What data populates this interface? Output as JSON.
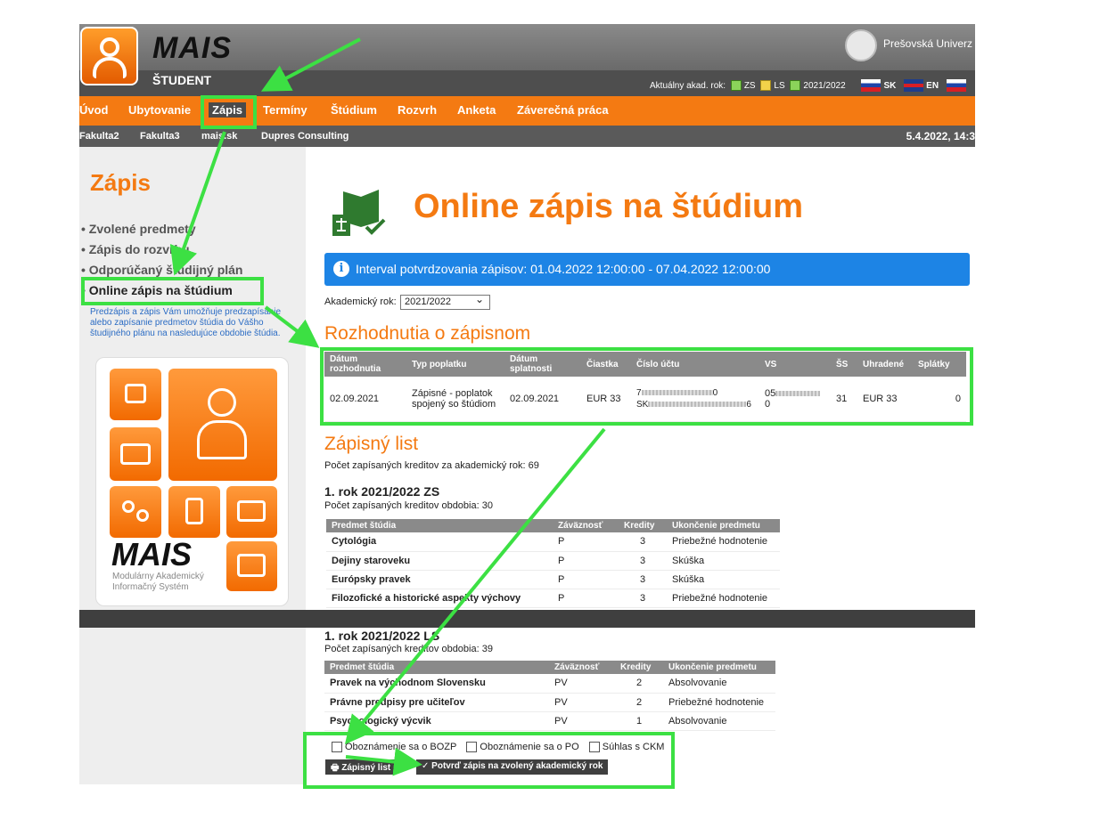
{
  "header": {
    "app_name": "MAIS",
    "role": "ŠTUDENT",
    "university": "Prešovská Univerz",
    "acad_year_label": "Aktuálny akad. rok:",
    "term_zs": "ZS",
    "term_ls": "LS",
    "current_year": "2021/2022",
    "lang_sk": "SK",
    "lang_en": "EN"
  },
  "nav": {
    "items": [
      "Úvod",
      "Ubytovanie",
      "Zápis",
      "Termíny",
      "Štúdium",
      "Rozvrh",
      "Anketa",
      "Záverečná práca"
    ],
    "active": "Zápis"
  },
  "subnav": {
    "items": [
      "Fakulta2",
      "Fakulta3",
      "mais.sk",
      "Dupres Consulting"
    ],
    "datetime": "5.4.2022, 14:3"
  },
  "sidebar": {
    "title": "Zápis",
    "links": [
      "Zvolené predmety",
      "Zápis do rozvrhu",
      "Odporúčaný študijný plán",
      "Online zápis na štúdium"
    ],
    "description": "Predzápis a zápis Vám umožňuje predzapísanie alebo zapísanie predmetov štúdia do Vášho študijného plánu na nasledujúce obdobie štúdia.",
    "brand": "MAIS",
    "brand_sub1": "Modulárny Akademický",
    "brand_sub2": "Informačný Systém"
  },
  "main": {
    "title": "Online zápis na štúdium",
    "info": "Interval potvrdzovania zápisov: 01.04.2022 12:00:00 - 07.04.2022 12:00:00",
    "year_label": "Akademický rok:",
    "year_value": "2021/2022",
    "decisions_title": "Rozhodnutia o zápisnom",
    "fee_headers": [
      "Dátum rozhodnutia",
      "Typ poplatku",
      "Dátum splatnosti",
      "Čiastka",
      "Číslo účtu",
      "VS",
      "ŠS",
      "Uhradené",
      "Splátky"
    ],
    "fee_row": {
      "date": "02.09.2021",
      "type": "Zápisné - poplatok spojený so štúdiom",
      "due": "02.09.2021",
      "amount": "EUR 33",
      "account_a": "7",
      "account_a_end": "0",
      "account_b": "SK",
      "account_b_end": "6",
      "vs_a": "05",
      "vs_end": "0",
      "ss": "31",
      "paid": "EUR 33",
      "installments": "0"
    },
    "sheet_title": "Zápisný list",
    "sheet_credits": "Počet zapísaných kreditov za akademický rok: 69",
    "subject_headers": [
      "Predmet štúdia",
      "Záväznosť",
      "Kredity",
      "Ukončenie predmetu"
    ],
    "semesters": [
      {
        "title": "1. rok 2021/2022 ZS",
        "credits": "Počet zapísaných kreditov obdobia: 30",
        "rows": [
          [
            "Cytológia",
            "P",
            "3",
            "Priebežné hodnotenie"
          ],
          [
            "Dejiny staroveku",
            "P",
            "3",
            "Skúška"
          ],
          [
            "Európsky pravek",
            "P",
            "3",
            "Skúška"
          ],
          [
            "Filozofické a historické aspekty výchovy",
            "P",
            "3",
            "Priebežné hodnotenie"
          ]
        ]
      },
      {
        "title": "1. rok 2021/2022 LS",
        "credits": "Počet zapísaných kreditov obdobia: 39",
        "rows": [
          [
            "Pravek na východnom Slovensku",
            "PV",
            "2",
            "Absolvovanie"
          ],
          [
            "Právne predpisy pre učiteľov",
            "PV",
            "2",
            "Priebežné hodnotenie"
          ],
          [
            "Psychologický výcvik",
            "PV",
            "1",
            "Absolvovanie"
          ]
        ]
      }
    ],
    "checkboxes": [
      "Oboznámenie sa o BOZP",
      "Oboznámenie sa o PO",
      "Súhlas s CKM"
    ],
    "btn_sheet": "Zápisný list",
    "btn_confirm": "Potvrď zápis na zvolený akademický rok"
  },
  "colors": {
    "accent": "#f47a12",
    "info": "#1d84e5",
    "highlight": "#3ce043"
  }
}
